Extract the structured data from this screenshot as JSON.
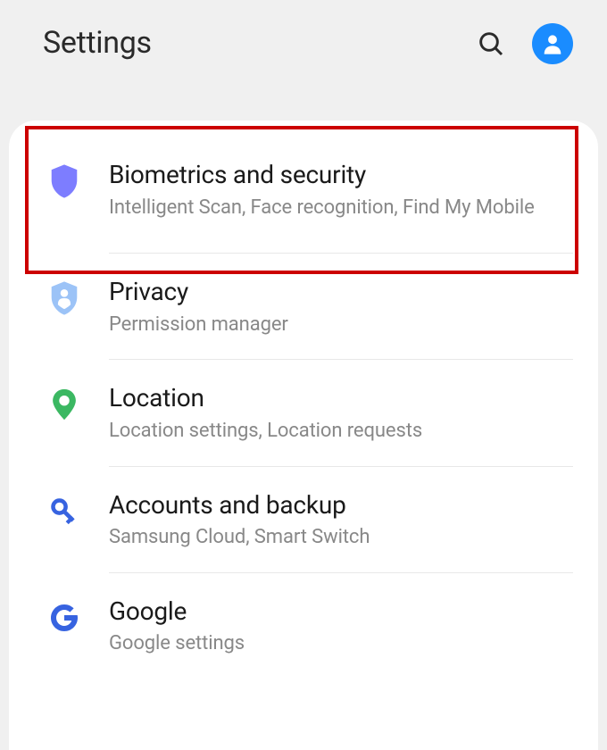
{
  "header": {
    "title": "Settings"
  },
  "items": [
    {
      "title": "Biometrics and security",
      "subtitle": "Intelligent Scan, Face recognition, Find My Mobile"
    },
    {
      "title": "Privacy",
      "subtitle": "Permission manager"
    },
    {
      "title": "Location",
      "subtitle": "Location settings, Location requests"
    },
    {
      "title": "Accounts and backup",
      "subtitle": "Samsung Cloud, Smart Switch"
    },
    {
      "title": "Google",
      "subtitle": "Google settings"
    }
  ]
}
